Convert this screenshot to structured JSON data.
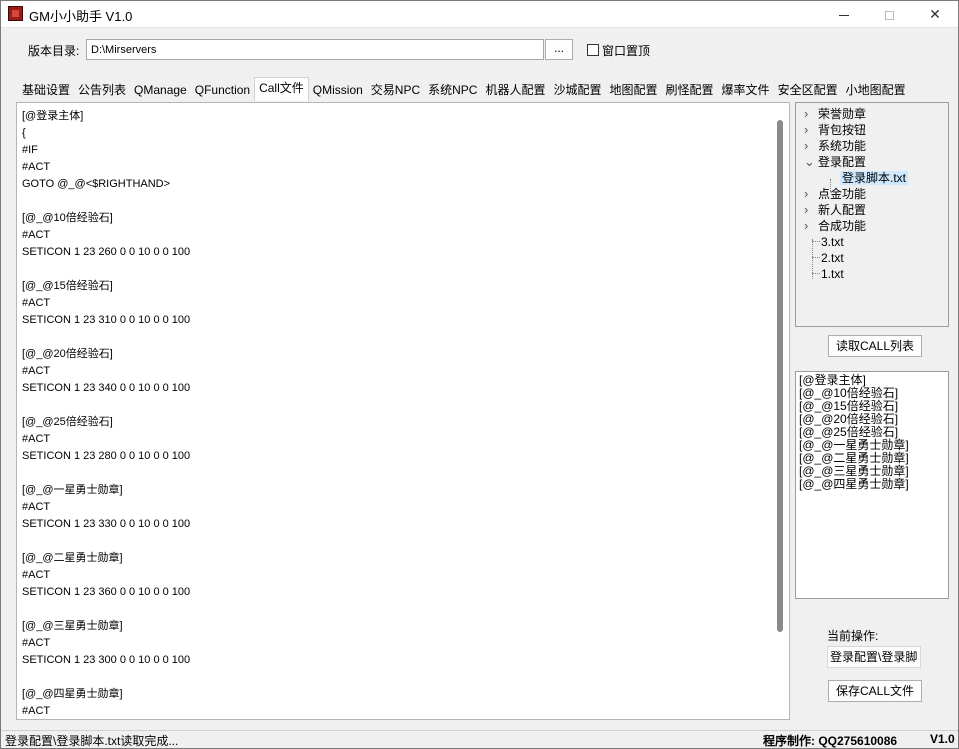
{
  "window": {
    "title": "GM小小助手 V1.0"
  },
  "toolbar": {
    "dir_label": "版本目录:",
    "dir_value": "D:\\Mirservers",
    "browse_label": "...",
    "topmost_label": "窗口置顶",
    "topmost_checked": false
  },
  "tabs": [
    {
      "label": "基础设置"
    },
    {
      "label": "公告列表"
    },
    {
      "label": "QManage"
    },
    {
      "label": "QFunction"
    },
    {
      "label": "Call文件",
      "active": true
    },
    {
      "label": "QMission"
    },
    {
      "label": "交易NPC"
    },
    {
      "label": "系统NPC"
    },
    {
      "label": "机器人配置"
    },
    {
      "label": "沙城配置"
    },
    {
      "label": "地图配置"
    },
    {
      "label": "刷怪配置"
    },
    {
      "label": "爆率文件"
    },
    {
      "label": "安全区配置"
    },
    {
      "label": "小地图配置"
    }
  ],
  "editor": {
    "lines": [
      "[@登录主体]",
      "{",
      "#IF",
      "#ACT",
      "GOTO @_@<$RIGHTHAND>",
      "",
      "[@_@10倍经验石]",
      "#ACT",
      "SETICON 1 23 260 0 0 10 0 0 100",
      "",
      "[@_@15倍经验石]",
      "#ACT",
      "SETICON 1 23 310 0 0 10 0 0 100",
      "",
      "[@_@20倍经验石]",
      "#ACT",
      "SETICON 1 23 340 0 0 10 0 0 100",
      "",
      "[@_@25倍经验石]",
      "#ACT",
      "SETICON 1 23 280 0 0 10 0 0 100",
      "",
      "[@_@一星勇士勋章]",
      "#ACT",
      "SETICON 1 23 330 0 0 10 0 0 100",
      "",
      "[@_@二星勇士勋章]",
      "#ACT",
      "SETICON 1 23 360 0 0 10 0 0 100",
      "",
      "[@_@三星勇士勋章]",
      "#ACT",
      "SETICON 1 23 300 0 0 10 0 0 100",
      "",
      "[@_@四星勇士勋章]",
      "#ACT"
    ]
  },
  "tree": {
    "nodes": [
      {
        "label": "荣誉勋章",
        "chevron": "right"
      },
      {
        "label": "背包按钮",
        "chevron": "right"
      },
      {
        "label": "系统功能",
        "chevron": "right"
      },
      {
        "label": "登录配置",
        "chevron": "down"
      },
      {
        "label": "登录脚本.txt",
        "selected": true,
        "child": true
      },
      {
        "label": "点金功能",
        "chevron": "right"
      },
      {
        "label": "新人配置",
        "chevron": "right"
      },
      {
        "label": "合成功能",
        "chevron": "right"
      },
      {
        "label": "3.txt",
        "leaf": true
      },
      {
        "label": "2.txt",
        "leaf": true
      },
      {
        "label": "1.txt",
        "leaf": true
      }
    ]
  },
  "read_call_button": "读取CALL列表",
  "call_list": [
    "[@登录主体]",
    "[@_@10倍经验石]",
    "[@_@15倍经验石]",
    "[@_@20倍经验石]",
    "[@_@25倍经验石]",
    "[@_@一星勇士勋章]",
    "[@_@二星勇士勋章]",
    "[@_@三星勇士勋章]",
    "[@_@四星勇士勋章]"
  ],
  "current_op": {
    "label": "当前操作:",
    "value": "登录配置\\登录脚"
  },
  "save_call_button": "保存CALL文件",
  "status": {
    "message": "登录配置\\登录脚本.txt读取完成...",
    "author": "程序制作:  QQ275610086",
    "version": "V1.0"
  }
}
